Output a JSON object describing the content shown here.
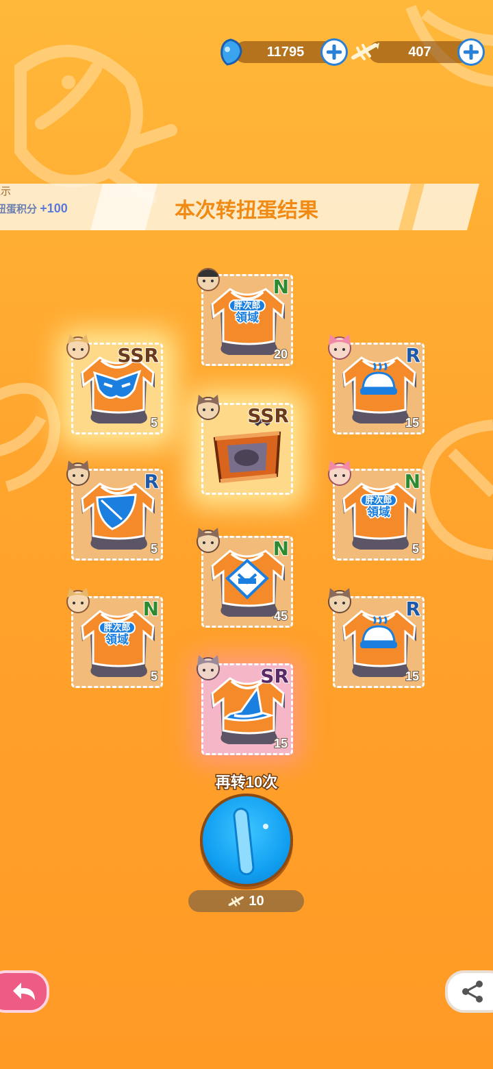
{
  "currencies": [
    {
      "name": "gem",
      "value": "11795",
      "icon": "blue-gem-icon"
    },
    {
      "name": "fishbone",
      "value": "407",
      "icon": "fishbone-ticket-icon"
    }
  ],
  "banner": {
    "title": "本次转扭蛋结果",
    "side_line1": "显示",
    "side_line2_prefix": "扭蛋积分",
    "side_line2_value": "+100"
  },
  "items": [
    {
      "rarity": "N",
      "count": "20",
      "design": "pangjilang-logo",
      "logo_top": "胖次郎",
      "logo_main": "領域",
      "avatar": "white-cap-girl"
    },
    {
      "rarity": "SSR",
      "count": "5",
      "design": "blue-mask",
      "avatar": "blonde-cat-girl"
    },
    {
      "rarity": "R",
      "count": "15",
      "design": "bell-icon",
      "avatar": "pink-cat-girl"
    },
    {
      "rarity": "SSR",
      "count": "",
      "design": "treasure-crate",
      "avatar": "brown-cat-girl"
    },
    {
      "rarity": "R",
      "count": "5",
      "design": "leaf",
      "avatar": "brown-cat-girl"
    },
    {
      "rarity": "N",
      "count": "5",
      "design": "pangjilang-logo",
      "logo_top": "胖次郎",
      "logo_main": "領域",
      "avatar": "pink-cat-girl"
    },
    {
      "rarity": "N",
      "count": "45",
      "design": "kimono",
      "avatar": "brown-cat-girl"
    },
    {
      "rarity": "N",
      "count": "5",
      "design": "pangjilang-logo",
      "logo_top": "胖次郎",
      "logo_main": "領域",
      "avatar": "blonde-cat-girl"
    },
    {
      "rarity": "R",
      "count": "15",
      "design": "bell-icon",
      "avatar": "brown-cat-girl"
    },
    {
      "rarity": "SR",
      "count": "15",
      "design": "witch-hat",
      "avatar": "silver-cat-girl"
    }
  ],
  "spin_again": {
    "label": "再转10次",
    "cost": "10"
  },
  "colors": {
    "accent": "#f08a13",
    "background": "#ffa42d",
    "button_blue": "#12a0f2",
    "back_pink": "#ee5b84"
  }
}
